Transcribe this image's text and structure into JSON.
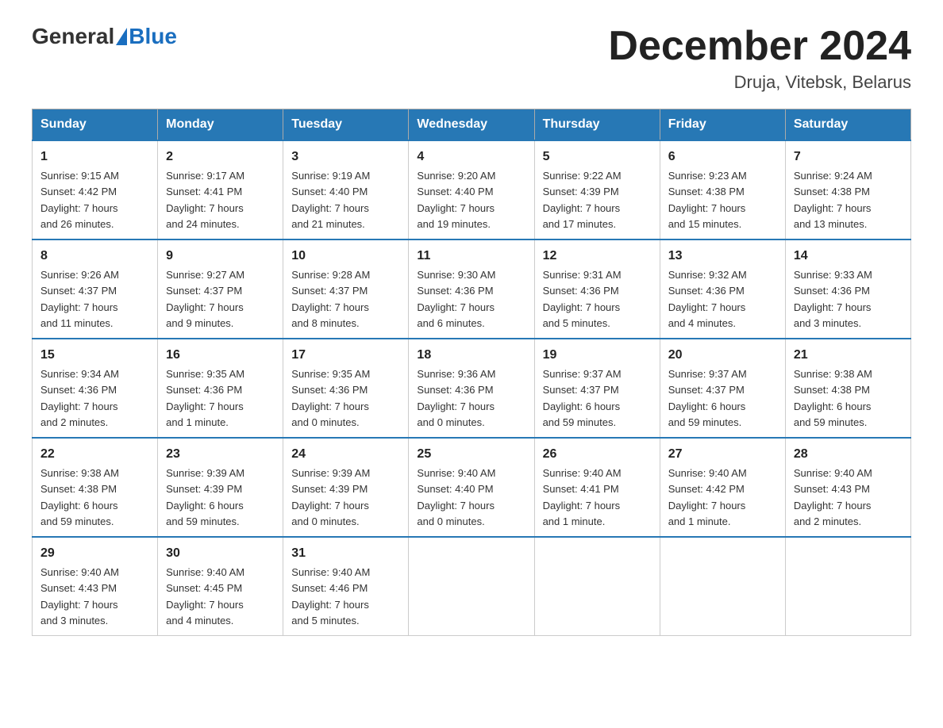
{
  "header": {
    "logo_general": "General",
    "logo_blue": "Blue",
    "month_title": "December 2024",
    "location": "Druja, Vitebsk, Belarus"
  },
  "weekdays": [
    "Sunday",
    "Monday",
    "Tuesday",
    "Wednesday",
    "Thursday",
    "Friday",
    "Saturday"
  ],
  "weeks": [
    [
      {
        "day": "1",
        "info": "Sunrise: 9:15 AM\nSunset: 4:42 PM\nDaylight: 7 hours\nand 26 minutes."
      },
      {
        "day": "2",
        "info": "Sunrise: 9:17 AM\nSunset: 4:41 PM\nDaylight: 7 hours\nand 24 minutes."
      },
      {
        "day": "3",
        "info": "Sunrise: 9:19 AM\nSunset: 4:40 PM\nDaylight: 7 hours\nand 21 minutes."
      },
      {
        "day": "4",
        "info": "Sunrise: 9:20 AM\nSunset: 4:40 PM\nDaylight: 7 hours\nand 19 minutes."
      },
      {
        "day": "5",
        "info": "Sunrise: 9:22 AM\nSunset: 4:39 PM\nDaylight: 7 hours\nand 17 minutes."
      },
      {
        "day": "6",
        "info": "Sunrise: 9:23 AM\nSunset: 4:38 PM\nDaylight: 7 hours\nand 15 minutes."
      },
      {
        "day": "7",
        "info": "Sunrise: 9:24 AM\nSunset: 4:38 PM\nDaylight: 7 hours\nand 13 minutes."
      }
    ],
    [
      {
        "day": "8",
        "info": "Sunrise: 9:26 AM\nSunset: 4:37 PM\nDaylight: 7 hours\nand 11 minutes."
      },
      {
        "day": "9",
        "info": "Sunrise: 9:27 AM\nSunset: 4:37 PM\nDaylight: 7 hours\nand 9 minutes."
      },
      {
        "day": "10",
        "info": "Sunrise: 9:28 AM\nSunset: 4:37 PM\nDaylight: 7 hours\nand 8 minutes."
      },
      {
        "day": "11",
        "info": "Sunrise: 9:30 AM\nSunset: 4:36 PM\nDaylight: 7 hours\nand 6 minutes."
      },
      {
        "day": "12",
        "info": "Sunrise: 9:31 AM\nSunset: 4:36 PM\nDaylight: 7 hours\nand 5 minutes."
      },
      {
        "day": "13",
        "info": "Sunrise: 9:32 AM\nSunset: 4:36 PM\nDaylight: 7 hours\nand 4 minutes."
      },
      {
        "day": "14",
        "info": "Sunrise: 9:33 AM\nSunset: 4:36 PM\nDaylight: 7 hours\nand 3 minutes."
      }
    ],
    [
      {
        "day": "15",
        "info": "Sunrise: 9:34 AM\nSunset: 4:36 PM\nDaylight: 7 hours\nand 2 minutes."
      },
      {
        "day": "16",
        "info": "Sunrise: 9:35 AM\nSunset: 4:36 PM\nDaylight: 7 hours\nand 1 minute."
      },
      {
        "day": "17",
        "info": "Sunrise: 9:35 AM\nSunset: 4:36 PM\nDaylight: 7 hours\nand 0 minutes."
      },
      {
        "day": "18",
        "info": "Sunrise: 9:36 AM\nSunset: 4:36 PM\nDaylight: 7 hours\nand 0 minutes."
      },
      {
        "day": "19",
        "info": "Sunrise: 9:37 AM\nSunset: 4:37 PM\nDaylight: 6 hours\nand 59 minutes."
      },
      {
        "day": "20",
        "info": "Sunrise: 9:37 AM\nSunset: 4:37 PM\nDaylight: 6 hours\nand 59 minutes."
      },
      {
        "day": "21",
        "info": "Sunrise: 9:38 AM\nSunset: 4:38 PM\nDaylight: 6 hours\nand 59 minutes."
      }
    ],
    [
      {
        "day": "22",
        "info": "Sunrise: 9:38 AM\nSunset: 4:38 PM\nDaylight: 6 hours\nand 59 minutes."
      },
      {
        "day": "23",
        "info": "Sunrise: 9:39 AM\nSunset: 4:39 PM\nDaylight: 6 hours\nand 59 minutes."
      },
      {
        "day": "24",
        "info": "Sunrise: 9:39 AM\nSunset: 4:39 PM\nDaylight: 7 hours\nand 0 minutes."
      },
      {
        "day": "25",
        "info": "Sunrise: 9:40 AM\nSunset: 4:40 PM\nDaylight: 7 hours\nand 0 minutes."
      },
      {
        "day": "26",
        "info": "Sunrise: 9:40 AM\nSunset: 4:41 PM\nDaylight: 7 hours\nand 1 minute."
      },
      {
        "day": "27",
        "info": "Sunrise: 9:40 AM\nSunset: 4:42 PM\nDaylight: 7 hours\nand 1 minute."
      },
      {
        "day": "28",
        "info": "Sunrise: 9:40 AM\nSunset: 4:43 PM\nDaylight: 7 hours\nand 2 minutes."
      }
    ],
    [
      {
        "day": "29",
        "info": "Sunrise: 9:40 AM\nSunset: 4:43 PM\nDaylight: 7 hours\nand 3 minutes."
      },
      {
        "day": "30",
        "info": "Sunrise: 9:40 AM\nSunset: 4:45 PM\nDaylight: 7 hours\nand 4 minutes."
      },
      {
        "day": "31",
        "info": "Sunrise: 9:40 AM\nSunset: 4:46 PM\nDaylight: 7 hours\nand 5 minutes."
      },
      null,
      null,
      null,
      null
    ]
  ]
}
